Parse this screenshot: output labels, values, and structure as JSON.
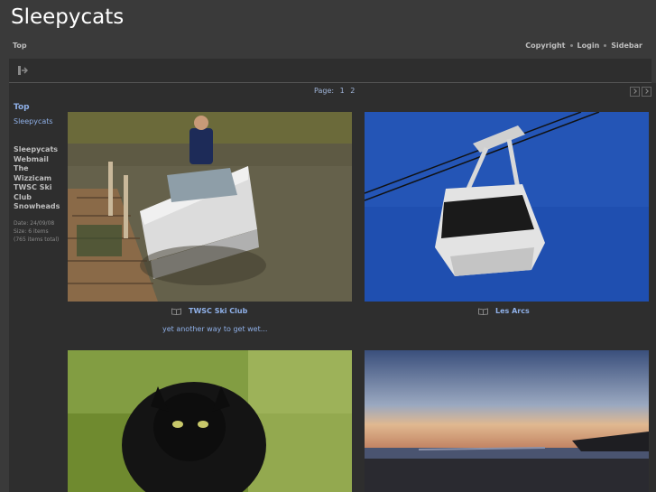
{
  "site": {
    "title": "Sleepycats"
  },
  "nav": {
    "top": "Top",
    "links": [
      "Copyright",
      "Login",
      "Sidebar"
    ]
  },
  "pager": {
    "label": "Page:",
    "pages": [
      "1",
      "2"
    ]
  },
  "sidebar": {
    "top": "Top",
    "current": "Sleepycats",
    "items": [
      "Sleepycats",
      "Webmail",
      "The",
      "Wizzicam",
      "TWSC Ski",
      "Club",
      "Snowheads"
    ],
    "meta": [
      "Date: 24/09/08",
      "Size: 6 items",
      "(765 items total)"
    ]
  },
  "gallery": [
    {
      "title": "TWSC Ski Club",
      "description": "yet another way to get wet..."
    },
    {
      "title": "Les Arcs",
      "description": ""
    }
  ],
  "colors": {
    "bg": "#3a3a3a",
    "panel": "#2e2e2e",
    "link": "#8fb0e8"
  }
}
